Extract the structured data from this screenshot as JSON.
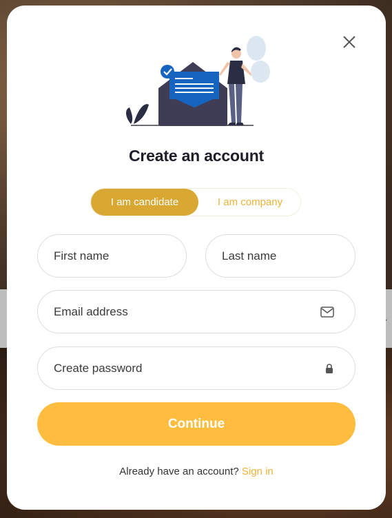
{
  "modal": {
    "title": "Create an account",
    "close_icon": "close-icon",
    "illustration": "envelope-person-illustration"
  },
  "role_toggle": {
    "options": [
      "I am candidate",
      "I am company"
    ],
    "selected": "I am candidate"
  },
  "form": {
    "first_name": {
      "placeholder": "First name",
      "value": ""
    },
    "last_name": {
      "placeholder": "Last name",
      "value": ""
    },
    "email": {
      "placeholder": "Email address",
      "value": "",
      "icon": "envelope-icon"
    },
    "password": {
      "placeholder": "Create password",
      "value": "",
      "icon": "lock-icon"
    }
  },
  "continue_label": "Continue",
  "signin": {
    "prompt": "Already have an account?",
    "link": "Sign in"
  },
  "colors": {
    "accent": "#ffbd40",
    "toggle_active": "#d9a833",
    "link": "#f0b23a",
    "illustration_blue": "#1565c0"
  }
}
